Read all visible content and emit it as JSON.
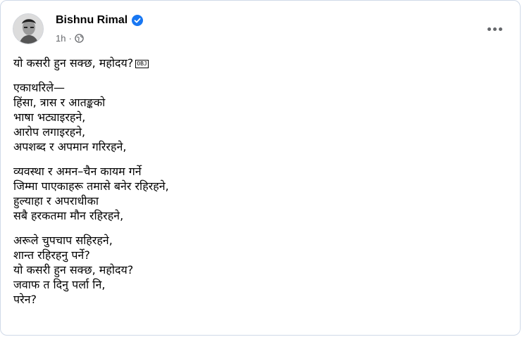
{
  "post": {
    "author": "Bishnu Rimal",
    "time": "1h",
    "separator": "·",
    "verified_icon": "verified-badge-icon",
    "privacy_icon": "globe-icon",
    "more_icon": "more-options-icon",
    "accent_color": "#1877f2",
    "obj_glyph": "OBJ",
    "paragraphs": [
      [
        "यो कसरी हुन सक्छ, महोदय?"
      ],
      [
        "एकाथरिले—",
        "हिंसा, त्रास र आतङ्कको",
        "भाषा भट्याइरहने,",
        "आरोप लगाइरहने,",
        "अपशब्द र अपमान गरिरहने,"
      ],
      [
        "व्यवस्था र अमन–चैन कायम गर्ने",
        "जिम्मा पाएकाहरू तमासे बनेर रहिरहने,",
        "हुल्याहा र अपराधीका",
        "सबै हरकतमा मौन रहिरहने,"
      ],
      [
        "अरूले चुपचाप सहिरहने,",
        "शान्त रहिरहनु पर्ने?",
        "यो कसरी हुन सक्छ, महोदय?",
        "जवाफ त दिनु पर्ला नि,",
        "परेन?"
      ]
    ]
  }
}
